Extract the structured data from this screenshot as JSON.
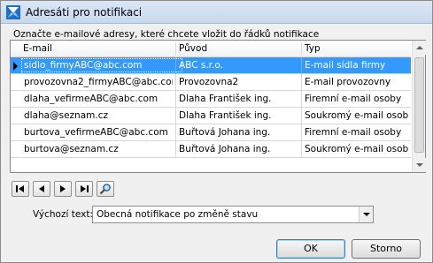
{
  "window": {
    "title": "Adresáti pro notifikaci"
  },
  "prompt": "Označte e-mailové adresy, které chcete vložit do řádků notifikace",
  "grid": {
    "columns": [
      "E-mail",
      "Původ",
      "Typ"
    ],
    "rows": [
      {
        "email": "sidlo_firmyABC@abc.com",
        "puvod": "ABC s.r.o.",
        "typ": "E-mail sídla firmy",
        "selected": true
      },
      {
        "email": "provozovna2_firmyABC@abc.com",
        "puvod": "Provozovna2",
        "typ": "E-mail provozovny",
        "selected": false
      },
      {
        "email": "dlaha_vefirmeABC@abc.com",
        "puvod": "Dlaha František ing.",
        "typ": "Firemní e-mail osoby",
        "selected": false
      },
      {
        "email": "dlaha@seznam.cz",
        "puvod": "Dlaha František ing.",
        "typ": "Soukromý e-mail osob",
        "selected": false
      },
      {
        "email": "burtova_vefirmeABC@abc.com",
        "puvod": "Buřtová Johana ing.",
        "typ": "Firemní e-mail osoby",
        "selected": false
      },
      {
        "email": "burtova@seznam.cz",
        "puvod": "Buřtová Johana ing.",
        "typ": "Soukromý e-mail osob",
        "selected": false
      }
    ]
  },
  "navigation": {
    "icons": [
      "first-record-icon",
      "previous-record-icon",
      "next-record-icon",
      "last-record-icon",
      "search-icon"
    ]
  },
  "default_text": {
    "label": "Výchozí text:",
    "value": "Obecná notifikace po změně stavu"
  },
  "buttons": {
    "ok": "OK",
    "cancel": "Storno"
  },
  "colors": {
    "selection": "#3399ff",
    "titlebar": "#dbe7f5"
  }
}
